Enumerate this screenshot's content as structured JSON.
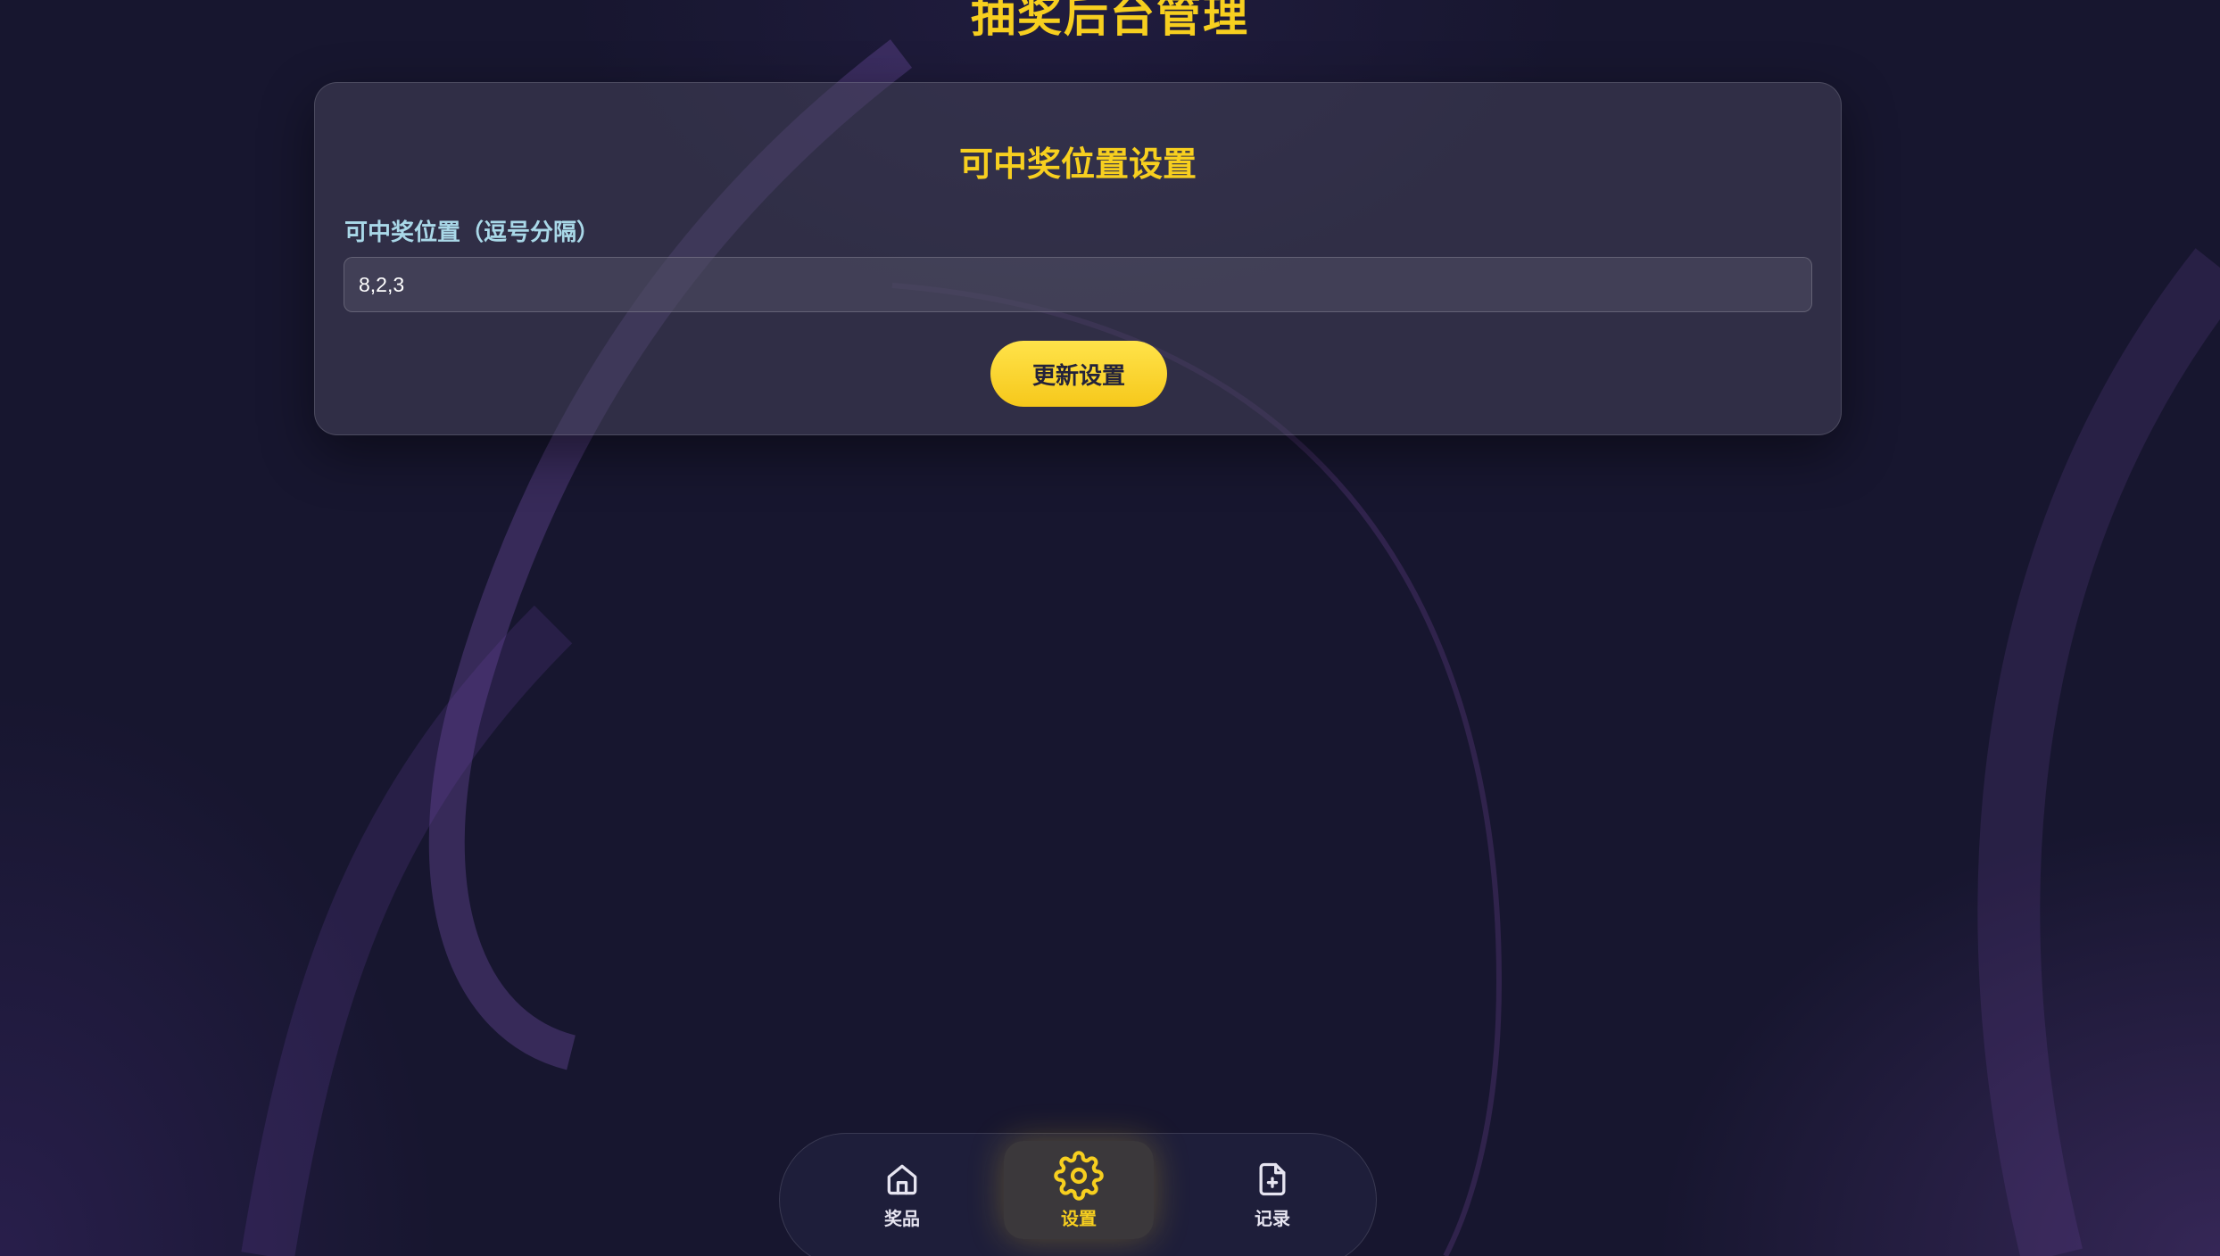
{
  "header": {
    "title": "抽奖后台管理"
  },
  "settings_card": {
    "title": "可中奖位置设置",
    "field_label": "可中奖位置（逗号分隔）",
    "positions_value": "8,2,3",
    "update_button": "更新设置"
  },
  "bottom_nav": {
    "items": [
      {
        "label": "奖品",
        "icon": "home-icon",
        "active": false
      },
      {
        "label": "设置",
        "icon": "gear-icon",
        "active": true
      },
      {
        "label": "记录",
        "icon": "file-plus-icon",
        "active": false
      }
    ]
  },
  "colors": {
    "accent": "#f7cf1f",
    "label": "#a9d8e8",
    "background": "#17162f"
  }
}
